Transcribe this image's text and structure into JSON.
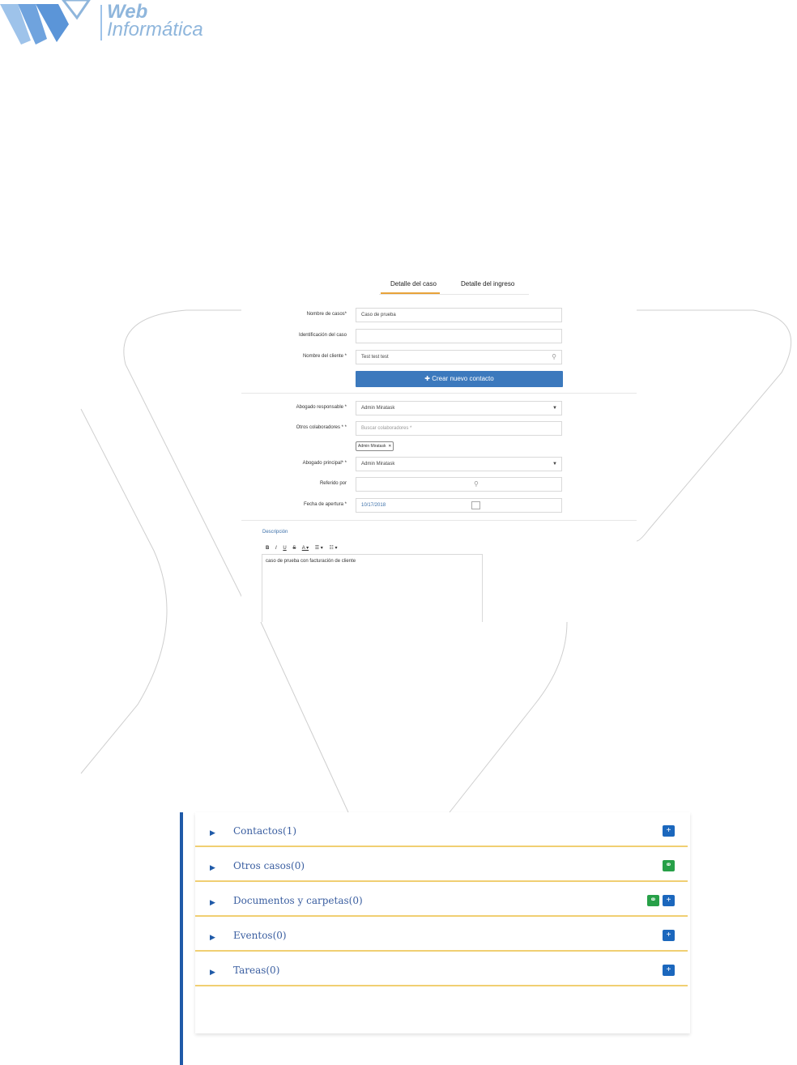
{
  "logo": {
    "line1": "Web",
    "line2": "Informática"
  },
  "tabs": [
    {
      "label": "Detalle del caso",
      "active": true
    },
    {
      "label": "Detalle del ingreso",
      "active": false
    }
  ],
  "form": {
    "case_name": {
      "label": "Nombre de casos*",
      "value": "Caso de prueba"
    },
    "case_id": {
      "label": "Identificación del caso",
      "value": ""
    },
    "client_name": {
      "label": "Nombre del cliente *",
      "value": "Test test test"
    },
    "create_contact_button": "Crear nuevo contacto",
    "responsible_lawyer": {
      "label": "Abogado responsable *",
      "value": "Admin Miratask"
    },
    "collaborators": {
      "label": "Otros colaboradores * *",
      "placeholder": "Buscar colaboradores *",
      "chip": "Admin Miratask"
    },
    "main_lawyer": {
      "label": "Abogado principal* *",
      "value": "Admin Miratask"
    },
    "referred_by": {
      "label": "Referido por",
      "value": ""
    },
    "opening_date": {
      "label": "Fecha de apertura *",
      "value": "10/17/2018"
    },
    "description": {
      "label": "Descripción",
      "toolbar": [
        "B",
        "I",
        "U",
        "S",
        "A ▾",
        "☰ ▾",
        "☷ ▾"
      ],
      "text": "caso de prueba con facturación de cliente"
    }
  },
  "accordion": [
    {
      "title": "Contactos(1)",
      "buttons": [
        "blue"
      ]
    },
    {
      "title": "Otros casos(0)",
      "buttons": [
        "green"
      ]
    },
    {
      "title": "Documentos y carpetas(0)",
      "buttons": [
        "green",
        "blue"
      ]
    },
    {
      "title": "Eventos(0)",
      "buttons": [
        "blue"
      ]
    },
    {
      "title": "Tareas(0)",
      "buttons": [
        "blue"
      ]
    }
  ],
  "colors": {
    "accent_blue": "#3c79bd",
    "tab_underline": "#e8a33a",
    "accordion_divider": "#f0cf72",
    "green_button": "#27a048",
    "blue_button": "#1b67bd"
  }
}
